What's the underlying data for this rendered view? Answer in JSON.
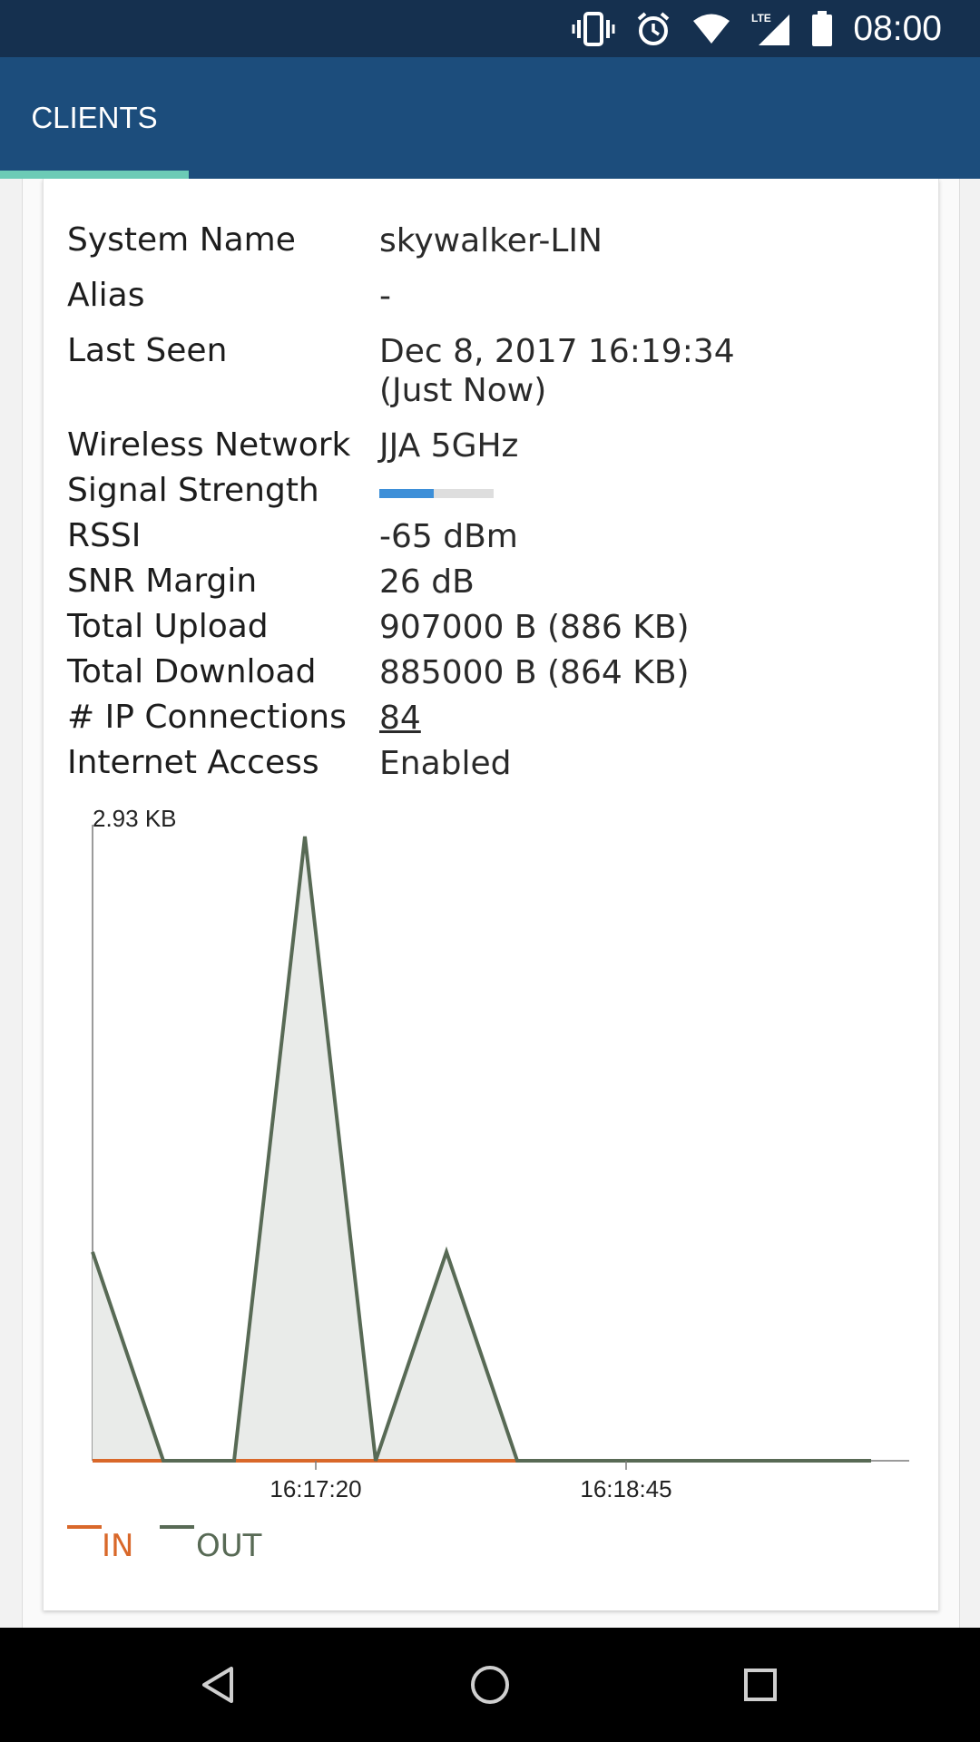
{
  "status_bar": {
    "time": "08:00",
    "icons": [
      "vibrate-icon",
      "alarm-icon",
      "wifi-icon",
      "lte-signal-icon",
      "battery-icon"
    ],
    "network_type": "LTE"
  },
  "app_bar": {
    "tabs": [
      {
        "label": "CLIENTS",
        "active": true
      }
    ],
    "colors": {
      "bar": "#1c4d7c",
      "indicator": "#6ccbb6"
    }
  },
  "client": {
    "system_name": {
      "label": "System Name",
      "value": "skywalker-LIN"
    },
    "alias": {
      "label": "Alias",
      "value": "-"
    },
    "last_seen": {
      "label": "Last Seen",
      "value": "Dec 8, 2017 16:19:34",
      "relative": "(Just Now)"
    },
    "wireless_network": {
      "label": "Wireless Network",
      "value": "JJA 5GHz"
    },
    "signal_strength": {
      "label": "Signal Strength",
      "level": 0.48
    },
    "rssi": {
      "label": "RSSI",
      "value": "-65 dBm"
    },
    "snr_margin": {
      "label": "SNR Margin",
      "value": "26 dB"
    },
    "total_upload": {
      "label": "Total Upload",
      "value": "907000 B (886 KB)"
    },
    "total_download": {
      "label": "Total Download",
      "value": "885000 B (864 KB)"
    },
    "ip_connections": {
      "label": "# IP Connections",
      "value": "84"
    },
    "internet_access": {
      "label": "Internet Access",
      "value": "Enabled"
    }
  },
  "chart_data": {
    "type": "area",
    "title": "",
    "y_max_label": "2.93 KB",
    "x_ticks": [
      "16:17:20",
      "16:18:45"
    ],
    "ylim": [
      0,
      2.93
    ],
    "series": [
      {
        "name": "IN",
        "color": "#d9682a",
        "values": [
          0,
          0,
          0,
          0,
          0,
          0,
          0,
          0,
          0,
          0,
          0,
          0
        ]
      },
      {
        "name": "OUT",
        "color": "#586a55",
        "values": [
          0.98,
          0,
          0,
          2.93,
          0,
          0.98,
          0,
          0,
          0,
          0,
          0,
          0
        ]
      }
    ],
    "colors": {
      "area_fill": "#e9ebe9",
      "axis": "#7a7a7a"
    }
  },
  "nav_bar": {
    "buttons": [
      "back-icon",
      "home-icon",
      "recents-icon"
    ]
  }
}
